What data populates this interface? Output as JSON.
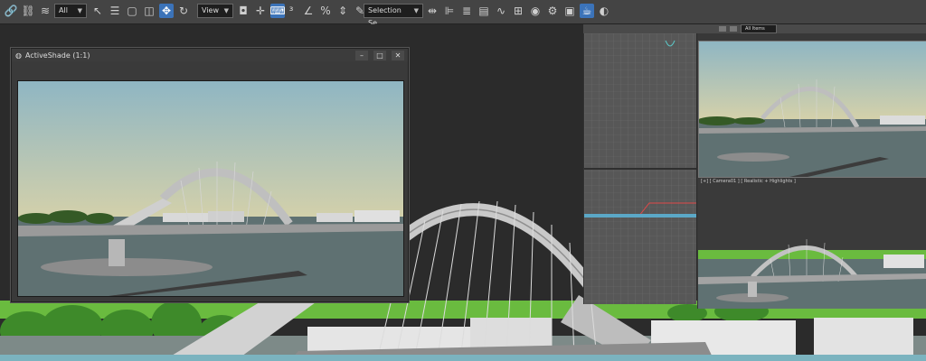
{
  "toolbar": {
    "selection_filter": "All",
    "reference_coord": "View",
    "named_selection": "Create Selection Se"
  },
  "activeshade": {
    "title": "ActiveShade (1:1)"
  },
  "viewport_side": {
    "label": "[+] [ Camera01 ] [ Realistic + Highlights ]",
    "camera_dropdown": "All Items"
  },
  "colors": {
    "toolbar_bg": "#444444",
    "active_button": "#3b73b9",
    "viewport_bg": "#2b2b2b",
    "grass": "#6abb3f",
    "sky_top": "#8fb6c3",
    "sky_bottom": "#d7d2a9",
    "water": "#5f7172"
  }
}
